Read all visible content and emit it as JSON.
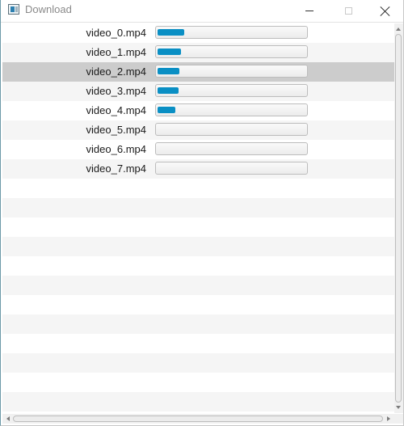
{
  "window": {
    "title": "Download",
    "app_icon": "window-app-icon",
    "controls": [
      "minimize-icon",
      "maximize-icon",
      "close-icon"
    ]
  },
  "downloads": [
    {
      "filename": "video_0.mp4",
      "progress": 0.18
    },
    {
      "filename": "video_1.mp4",
      "progress": 0.16
    },
    {
      "filename": "video_2.mp4",
      "progress": 0.15
    },
    {
      "filename": "video_3.mp4",
      "progress": 0.14
    },
    {
      "filename": "video_4.mp4",
      "progress": 0.12
    },
    {
      "filename": "video_5.mp4",
      "progress": 0
    },
    {
      "filename": "video_6.mp4",
      "progress": 0
    },
    {
      "filename": "video_7.mp4",
      "progress": 0
    }
  ],
  "selected_index": 2,
  "colors": {
    "progress_fill": "#0a8fc4",
    "selected_row": "#cccccc",
    "alternate_row": "#f5f5f5"
  }
}
